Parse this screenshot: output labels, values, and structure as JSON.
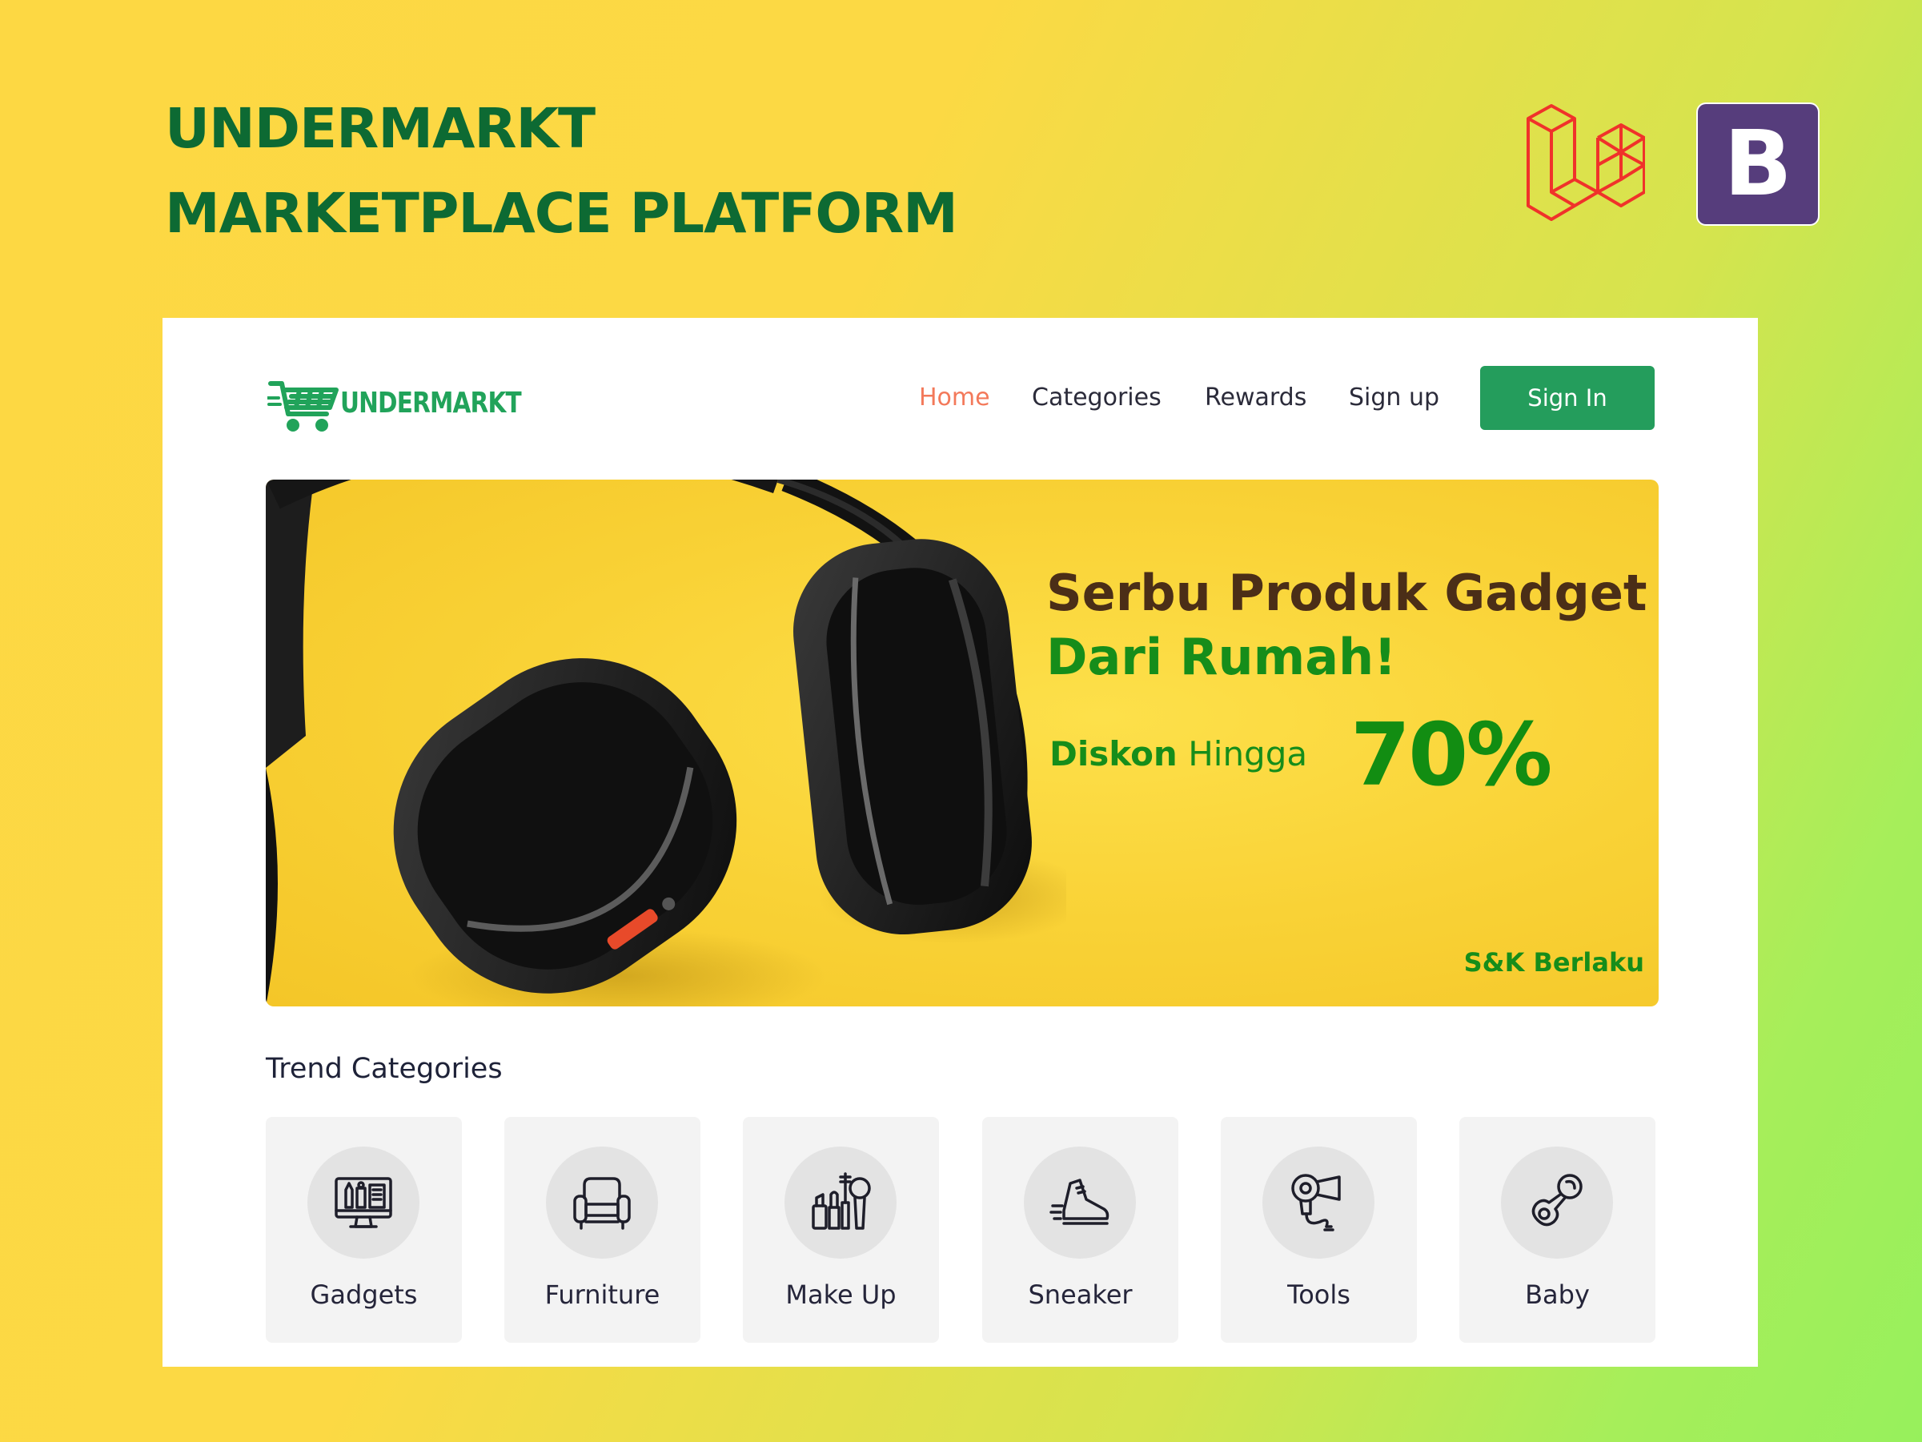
{
  "poster": {
    "title_line1": "UNDERMARKT",
    "title_line2": "MARKETPLACE PLATFORM",
    "title_color": "#0d6a33",
    "logos": [
      "laravel-icon",
      "bootstrap-icon"
    ],
    "bootstrap_letter": "B"
  },
  "site": {
    "logo_text": "UNDERMARKT",
    "brand_color": "#21a35a",
    "nav": {
      "items": [
        "Home",
        "Categories",
        "Rewards",
        "Sign up"
      ],
      "active": "Home",
      "active_color": "#f3795a",
      "signin_label": "Sign In"
    },
    "hero": {
      "headline_line1": "Serbu Produk Gadget",
      "headline_line2": "Dari Rumah!",
      "discount_bold": "Diskon",
      "discount_text": "Hingga",
      "discount_value": "70%",
      "terms": "S&K Berlaku"
    },
    "trend": {
      "title": "Trend Categories",
      "categories": [
        {
          "label": "Gadgets",
          "icon": "monitor-icon"
        },
        {
          "label": "Furniture",
          "icon": "armchair-icon"
        },
        {
          "label": "Make Up",
          "icon": "makeup-icon"
        },
        {
          "label": "Sneaker",
          "icon": "sneaker-icon"
        },
        {
          "label": "Tools",
          "icon": "hair-dryer-icon"
        },
        {
          "label": "Baby",
          "icon": "pacifier-icon"
        }
      ]
    }
  }
}
